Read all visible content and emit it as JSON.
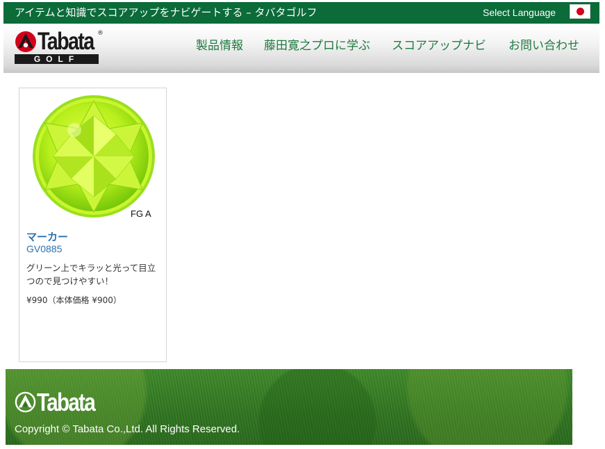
{
  "topbar": {
    "tagline": "アイテムと知識でスコアアップをナビゲートする – タバタゴルフ",
    "select_language": "Select Language",
    "flag_icon": "japan-flag-icon"
  },
  "header": {
    "logo_text": "Tabata",
    "logo_sub": "GOLF",
    "logo_reg": "®",
    "nav": [
      {
        "label": "製品情報"
      },
      {
        "label": "藤田寛之プロに学ぶ"
      },
      {
        "label": "スコアアップナビ"
      },
      {
        "label": "お問い合わせ"
      }
    ]
  },
  "product": {
    "badge": "FG A",
    "name": "マーカー",
    "code": "GV0885",
    "description": "グリーン上でキラッと光って目立つので見つけやすい！",
    "price": "¥990（本体価格 ¥900）",
    "image_icon": "green-crystal-marker-icon"
  },
  "footer": {
    "logo_text": "Tabata",
    "copyright": "Copyright © Tabata Co.,Ltd. All Rights Reserved."
  },
  "colors": {
    "brand_green": "#0b6b39",
    "nav_green": "#1f7a3f",
    "link_blue": "#2b6fb0",
    "logo_red": "#d0021b"
  }
}
